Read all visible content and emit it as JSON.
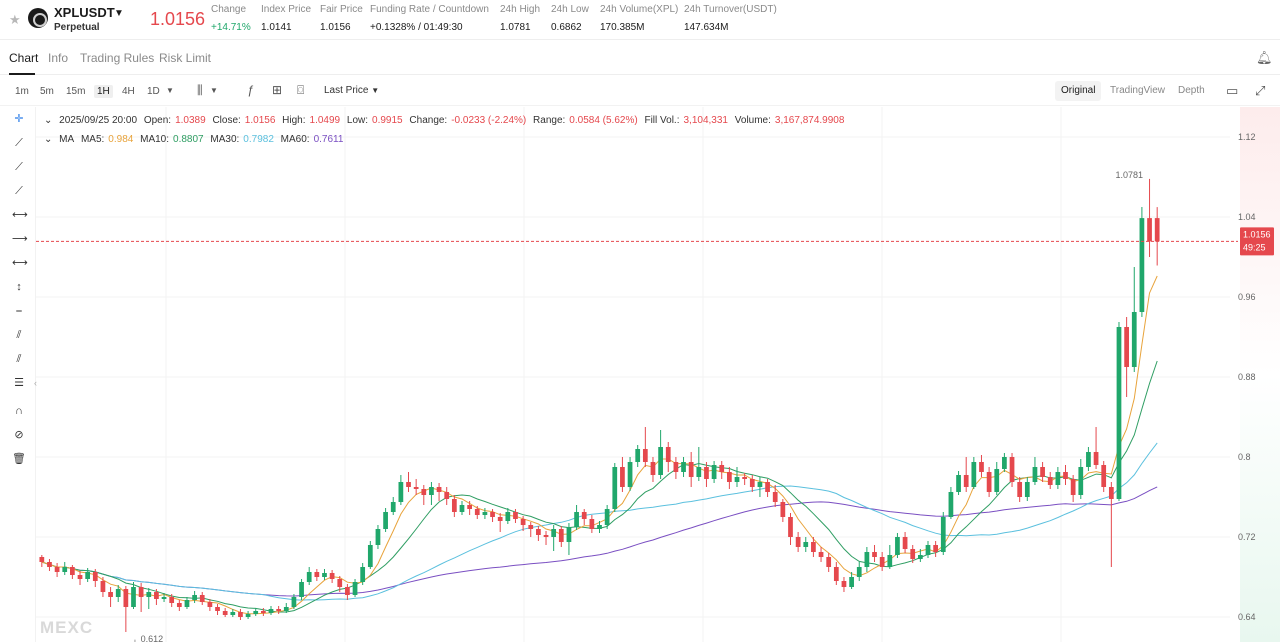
{
  "header": {
    "symbol": "XPLUSDT",
    "contract_type": "Perpetual",
    "last_price": "1.0156",
    "stats": [
      {
        "label": "Change",
        "value": "+14.71%",
        "positive": true
      },
      {
        "label": "Index Price",
        "value": "1.0141"
      },
      {
        "label": "Fair Price",
        "value": "1.0156"
      },
      {
        "label": "Funding Rate / Countdown",
        "value": "+0.1328% / 01:49:30"
      },
      {
        "label": "24h High",
        "value": "1.0781"
      },
      {
        "label": "24h Low",
        "value": "0.6862"
      },
      {
        "label": "24h Volume(XPL)",
        "value": "170.385M"
      },
      {
        "label": "24h Turnover(USDT)",
        "value": "147.634M"
      }
    ]
  },
  "tabs": [
    "Chart",
    "Info",
    "Trading Rules",
    "Risk Limit"
  ],
  "toolbar": {
    "timeframes": [
      "1m",
      "5m",
      "15m",
      "1H",
      "4H",
      "1D"
    ],
    "active_timeframe": "1H",
    "price_type": "Last Price",
    "views": [
      "Original",
      "TradingView",
      "Depth"
    ],
    "active_view": "Original"
  },
  "legend": {
    "date": "2025/09/25 20:00",
    "open_label": "Open:",
    "open": "1.0389",
    "close_label": "Close:",
    "close": "1.0156",
    "high_label": "High:",
    "high": "1.0499",
    "low_label": "Low:",
    "low": "0.9915",
    "change_label": "Change:",
    "change": "-0.0233 (-2.24%)",
    "range_label": "Range:",
    "range": "0.0584 (5.62%)",
    "fillvol_label": "Fill Vol.:",
    "fillvol": "3,104,331",
    "volume_label": "Volume:",
    "volume": "3,167,874.9908",
    "ma_label": "MA",
    "ma5_label": "MA5:",
    "ma5": "0.984",
    "ma10_label": "MA10:",
    "ma10": "0.8807",
    "ma30_label": "MA30:",
    "ma30": "0.7982",
    "ma60_label": "MA60:",
    "ma60": "0.7611"
  },
  "watermark": "MEXC",
  "colors": {
    "up": "#20a76b",
    "down": "#e5484d",
    "ma5": "#e8a33b",
    "ma10": "#2f9e63",
    "ma30": "#5bc0de",
    "ma60": "#7a4fc2"
  },
  "chart_data": {
    "type": "candlestick",
    "y_ticks": [
      "1.12",
      "1.04",
      "0.96",
      "0.88",
      "0.8",
      "0.72",
      "0.64"
    ],
    "ylim": [
      0.615,
      1.15
    ],
    "current_price_label": "1.0156",
    "countdown_label": "49:25",
    "high_label": "1.0781",
    "low_label": "0.612",
    "candles": [
      [
        0.7,
        0.695,
        0.702,
        0.69
      ],
      [
        0.695,
        0.69,
        0.698,
        0.686
      ],
      [
        0.69,
        0.685,
        0.694,
        0.68
      ],
      [
        0.685,
        0.69,
        0.695,
        0.682
      ],
      [
        0.69,
        0.682,
        0.692,
        0.678
      ],
      [
        0.682,
        0.678,
        0.686,
        0.672
      ],
      [
        0.678,
        0.685,
        0.689,
        0.675
      ],
      [
        0.685,
        0.676,
        0.688,
        0.67
      ],
      [
        0.676,
        0.665,
        0.68,
        0.66
      ],
      [
        0.665,
        0.66,
        0.67,
        0.65
      ],
      [
        0.66,
        0.668,
        0.672,
        0.655
      ],
      [
        0.668,
        0.65,
        0.671,
        0.625
      ],
      [
        0.65,
        0.67,
        0.675,
        0.648
      ],
      [
        0.67,
        0.66,
        0.674,
        0.645
      ],
      [
        0.66,
        0.665,
        0.669,
        0.648
      ],
      [
        0.665,
        0.658,
        0.668,
        0.652
      ],
      [
        0.658,
        0.66,
        0.664,
        0.655
      ],
      [
        0.66,
        0.654,
        0.663,
        0.65
      ],
      [
        0.654,
        0.65,
        0.657,
        0.646
      ],
      [
        0.65,
        0.657,
        0.66,
        0.648
      ],
      [
        0.657,
        0.662,
        0.666,
        0.654
      ],
      [
        0.662,
        0.655,
        0.665,
        0.652
      ],
      [
        0.655,
        0.65,
        0.658,
        0.646
      ],
      [
        0.65,
        0.646,
        0.653,
        0.642
      ],
      [
        0.646,
        0.642,
        0.649,
        0.64
      ],
      [
        0.642,
        0.645,
        0.648,
        0.64
      ],
      [
        0.645,
        0.64,
        0.648,
        0.637
      ],
      [
        0.64,
        0.643,
        0.646,
        0.638
      ],
      [
        0.643,
        0.646,
        0.649,
        0.641
      ],
      [
        0.646,
        0.644,
        0.649,
        0.641
      ],
      [
        0.644,
        0.648,
        0.651,
        0.642
      ],
      [
        0.648,
        0.646,
        0.651,
        0.643
      ],
      [
        0.646,
        0.65,
        0.654,
        0.644
      ],
      [
        0.65,
        0.66,
        0.663,
        0.648
      ],
      [
        0.66,
        0.675,
        0.678,
        0.657
      ],
      [
        0.675,
        0.685,
        0.69,
        0.672
      ],
      [
        0.685,
        0.68,
        0.688,
        0.676
      ],
      [
        0.68,
        0.684,
        0.688,
        0.677
      ],
      [
        0.684,
        0.678,
        0.687,
        0.674
      ],
      [
        0.678,
        0.67,
        0.681,
        0.665
      ],
      [
        0.67,
        0.662,
        0.673,
        0.657
      ],
      [
        0.662,
        0.675,
        0.678,
        0.66
      ],
      [
        0.675,
        0.69,
        0.694,
        0.672
      ],
      [
        0.69,
        0.712,
        0.716,
        0.688
      ],
      [
        0.712,
        0.728,
        0.732,
        0.708
      ],
      [
        0.728,
        0.745,
        0.749,
        0.725
      ],
      [
        0.745,
        0.755,
        0.76,
        0.742
      ],
      [
        0.755,
        0.775,
        0.782,
        0.752
      ],
      [
        0.775,
        0.77,
        0.785,
        0.765
      ],
      [
        0.77,
        0.768,
        0.778,
        0.762
      ],
      [
        0.768,
        0.762,
        0.772,
        0.752
      ],
      [
        0.762,
        0.77,
        0.775,
        0.752
      ],
      [
        0.77,
        0.765,
        0.774,
        0.756
      ],
      [
        0.765,
        0.758,
        0.77,
        0.752
      ],
      [
        0.758,
        0.745,
        0.762,
        0.74
      ],
      [
        0.745,
        0.752,
        0.756,
        0.742
      ],
      [
        0.752,
        0.748,
        0.756,
        0.742
      ],
      [
        0.748,
        0.742,
        0.751,
        0.738
      ],
      [
        0.742,
        0.745,
        0.749,
        0.738
      ],
      [
        0.745,
        0.74,
        0.748,
        0.735
      ],
      [
        0.74,
        0.736,
        0.744,
        0.725
      ],
      [
        0.736,
        0.745,
        0.749,
        0.733
      ],
      [
        0.745,
        0.738,
        0.748,
        0.734
      ],
      [
        0.738,
        0.732,
        0.741,
        0.726
      ],
      [
        0.732,
        0.728,
        0.735,
        0.72
      ],
      [
        0.728,
        0.722,
        0.731,
        0.716
      ],
      [
        0.722,
        0.72,
        0.726,
        0.712
      ],
      [
        0.72,
        0.728,
        0.732,
        0.706
      ],
      [
        0.728,
        0.715,
        0.731,
        0.71
      ],
      [
        0.715,
        0.73,
        0.734,
        0.702
      ],
      [
        0.73,
        0.745,
        0.752,
        0.727
      ],
      [
        0.745,
        0.738,
        0.748,
        0.732
      ],
      [
        0.738,
        0.728,
        0.742,
        0.724
      ],
      [
        0.728,
        0.732,
        0.736,
        0.724
      ],
      [
        0.732,
        0.748,
        0.752,
        0.728
      ],
      [
        0.748,
        0.79,
        0.794,
        0.745
      ],
      [
        0.79,
        0.77,
        0.8,
        0.765
      ],
      [
        0.77,
        0.795,
        0.8,
        0.766
      ],
      [
        0.795,
        0.808,
        0.812,
        0.79
      ],
      [
        0.808,
        0.795,
        0.83,
        0.79
      ],
      [
        0.795,
        0.782,
        0.8,
        0.775
      ],
      [
        0.782,
        0.81,
        0.827,
        0.778
      ],
      [
        0.81,
        0.795,
        0.815,
        0.785
      ],
      [
        0.795,
        0.785,
        0.8,
        0.778
      ],
      [
        0.785,
        0.795,
        0.8,
        0.78
      ],
      [
        0.795,
        0.78,
        0.805,
        0.77
      ],
      [
        0.78,
        0.79,
        0.81,
        0.776
      ],
      [
        0.79,
        0.778,
        0.795,
        0.77
      ],
      [
        0.778,
        0.792,
        0.796,
        0.774
      ],
      [
        0.792,
        0.785,
        0.796,
        0.778
      ],
      [
        0.785,
        0.775,
        0.79,
        0.768
      ],
      [
        0.775,
        0.78,
        0.79,
        0.77
      ],
      [
        0.78,
        0.778,
        0.784,
        0.772
      ],
      [
        0.778,
        0.77,
        0.782,
        0.765
      ],
      [
        0.77,
        0.775,
        0.78,
        0.76
      ],
      [
        0.775,
        0.765,
        0.778,
        0.76
      ],
      [
        0.765,
        0.755,
        0.772,
        0.75
      ],
      [
        0.755,
        0.74,
        0.758,
        0.735
      ],
      [
        0.74,
        0.72,
        0.744,
        0.712
      ],
      [
        0.72,
        0.71,
        0.725,
        0.705
      ],
      [
        0.71,
        0.715,
        0.72,
        0.705
      ],
      [
        0.715,
        0.705,
        0.72,
        0.7
      ],
      [
        0.705,
        0.7,
        0.71,
        0.695
      ],
      [
        0.7,
        0.69,
        0.704,
        0.685
      ],
      [
        0.69,
        0.676,
        0.695,
        0.672
      ],
      [
        0.676,
        0.67,
        0.68,
        0.665
      ],
      [
        0.67,
        0.68,
        0.685,
        0.668
      ],
      [
        0.68,
        0.69,
        0.695,
        0.676
      ],
      [
        0.69,
        0.705,
        0.71,
        0.685
      ],
      [
        0.705,
        0.7,
        0.712,
        0.695
      ],
      [
        0.7,
        0.69,
        0.705,
        0.686
      ],
      [
        0.69,
        0.702,
        0.712,
        0.688
      ],
      [
        0.702,
        0.72,
        0.724,
        0.699
      ],
      [
        0.72,
        0.708,
        0.725,
        0.704
      ],
      [
        0.708,
        0.698,
        0.712,
        0.694
      ],
      [
        0.698,
        0.702,
        0.708,
        0.695
      ],
      [
        0.702,
        0.712,
        0.716,
        0.699
      ],
      [
        0.712,
        0.705,
        0.716,
        0.7
      ],
      [
        0.705,
        0.74,
        0.745,
        0.702
      ],
      [
        0.74,
        0.765,
        0.77,
        0.738
      ],
      [
        0.765,
        0.782,
        0.786,
        0.762
      ],
      [
        0.782,
        0.77,
        0.8,
        0.765
      ],
      [
        0.77,
        0.795,
        0.8,
        0.768
      ],
      [
        0.795,
        0.785,
        0.802,
        0.78
      ],
      [
        0.785,
        0.765,
        0.79,
        0.76
      ],
      [
        0.765,
        0.788,
        0.795,
        0.762
      ],
      [
        0.788,
        0.8,
        0.804,
        0.785
      ],
      [
        0.8,
        0.775,
        0.804,
        0.77
      ],
      [
        0.775,
        0.76,
        0.78,
        0.755
      ],
      [
        0.76,
        0.775,
        0.78,
        0.756
      ],
      [
        0.775,
        0.79,
        0.8,
        0.772
      ],
      [
        0.79,
        0.78,
        0.795,
        0.775
      ],
      [
        0.78,
        0.772,
        0.785,
        0.768
      ],
      [
        0.772,
        0.785,
        0.79,
        0.768
      ],
      [
        0.785,
        0.778,
        0.792,
        0.772
      ],
      [
        0.778,
        0.762,
        0.782,
        0.755
      ],
      [
        0.762,
        0.79,
        0.798,
        0.758
      ],
      [
        0.79,
        0.805,
        0.81,
        0.786
      ],
      [
        0.805,
        0.792,
        0.83,
        0.788
      ],
      [
        0.792,
        0.77,
        0.796,
        0.765
      ],
      [
        0.77,
        0.758,
        0.775,
        0.69
      ],
      [
        0.758,
        0.93,
        0.935,
        0.756
      ],
      [
        0.93,
        0.89,
        0.94,
        0.86
      ],
      [
        0.89,
        0.945,
        0.99,
        0.885
      ],
      [
        0.945,
        1.0389,
        1.05,
        0.94
      ],
      [
        1.0389,
        1.0156,
        1.0781,
        1.0
      ],
      [
        1.0389,
        1.0156,
        1.0499,
        0.9915
      ]
    ]
  }
}
